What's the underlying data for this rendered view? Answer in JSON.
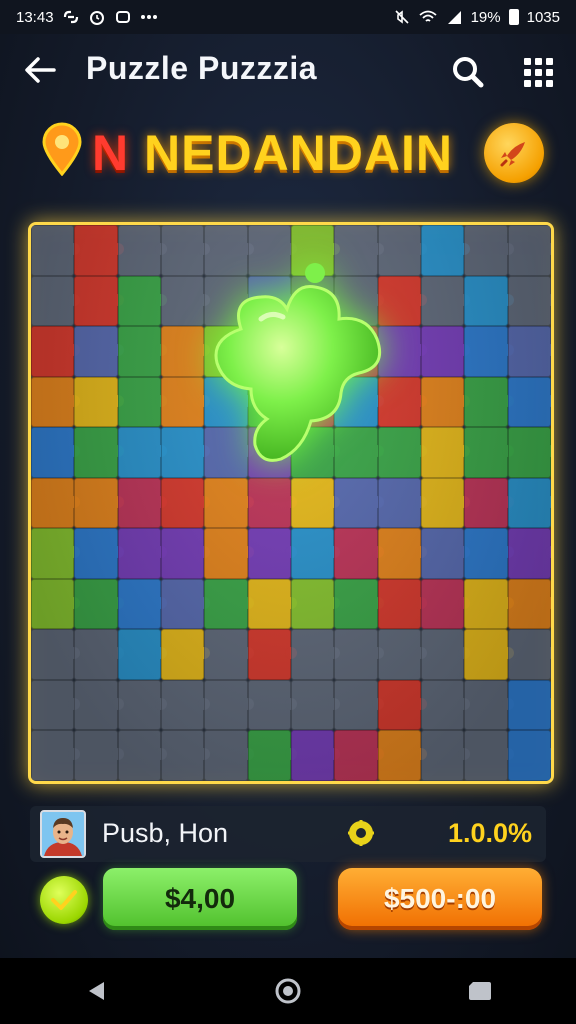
{
  "status_bar": {
    "time": "13:43",
    "battery": "19%",
    "clock_right": "1035",
    "icons": [
      "link-icon",
      "alarm-icon",
      "app-icon",
      "more-dots-icon",
      "mute-icon",
      "wifi-icon",
      "signal-icon",
      "battery-icon"
    ]
  },
  "header": {
    "title": "Puzzle  Puzzzia",
    "icons": [
      "back-arrow-icon",
      "search-icon",
      "grid-menu-icon"
    ]
  },
  "banner": {
    "title_first": "N",
    "title_rest": " NEDANDAIN",
    "left_icon": "map-pin-icon",
    "right_icon": "rocket-icon",
    "colors": {
      "gold": "#ffd21e",
      "red": "#ff3b2f"
    }
  },
  "board": {
    "columns": 12,
    "rows": 11,
    "frame_color": "#ffd94a",
    "palette": [
      "#2f80d8",
      "#e23b2e",
      "#f08a1c",
      "#7b3fc0",
      "#3cae4a",
      "#8ccc30",
      "#2a9ad6",
      "#c8365c",
      "#f2c21a",
      "#5b6fb8",
      "#6a7486",
      "#3d8c9c"
    ],
    "active_piece_color": "#7ef04a"
  },
  "player": {
    "name": "Pusb, Hon",
    "avatar_icon": "player-avatar",
    "coin_icon": "coin-icon",
    "progress_text": "1.0.0%"
  },
  "actions": {
    "check_icon": "checkmark-icon",
    "green_label": "$4,00",
    "orange_label": "$500-:00"
  },
  "nav": {
    "icons": [
      "nav-back-icon",
      "nav-home-icon",
      "nav-recents-icon"
    ]
  }
}
